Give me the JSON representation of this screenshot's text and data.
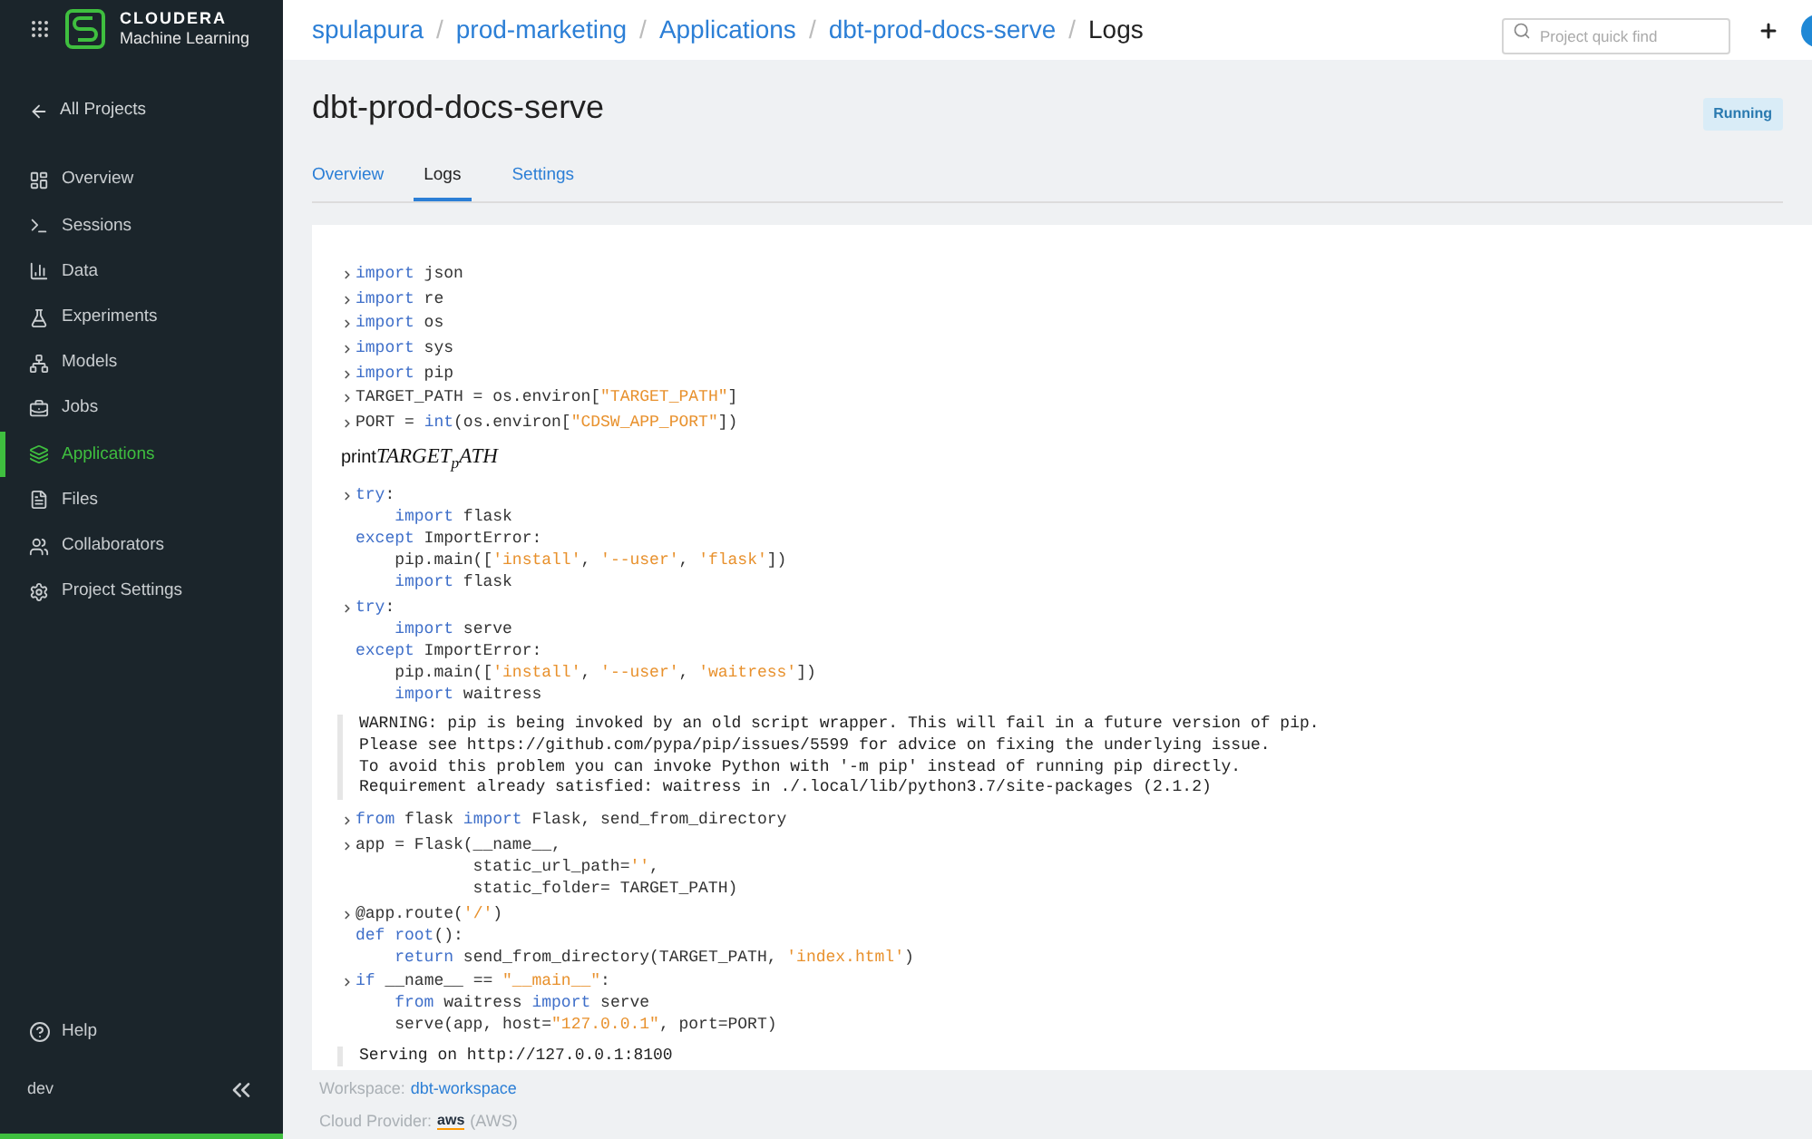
{
  "sidebar": {
    "brand": {
      "name": "CLOUDERA",
      "product": "Machine Learning"
    },
    "back_link": "All Projects",
    "items": [
      {
        "kind": "overview",
        "label": "Overview",
        "selected": false
      },
      {
        "kind": "sessions",
        "label": "Sessions",
        "selected": false
      },
      {
        "kind": "data",
        "label": "Data",
        "selected": false
      },
      {
        "kind": "experiments",
        "label": "Experiments",
        "selected": false
      },
      {
        "kind": "models",
        "label": "Models",
        "selected": false
      },
      {
        "kind": "jobs",
        "label": "Jobs",
        "selected": false
      },
      {
        "kind": "applications",
        "label": "Applications",
        "selected": true
      },
      {
        "kind": "files",
        "label": "Files",
        "selected": false
      },
      {
        "kind": "collaborators",
        "label": "Collaborators",
        "selected": false
      },
      {
        "kind": "settings",
        "label": "Project Settings",
        "selected": false
      }
    ],
    "help": "Help",
    "user": "dev"
  },
  "topbar": {
    "breadcrumb": [
      {
        "label": "spulapura",
        "link": true
      },
      {
        "label": "prod-marketing",
        "link": true
      },
      {
        "label": "Applications",
        "link": true
      },
      {
        "label": "dbt-prod-docs-serve",
        "link": true
      },
      {
        "label": "Logs",
        "link": false
      }
    ],
    "separator": "/",
    "search": {
      "placeholder": "Project quick find"
    }
  },
  "page": {
    "title": "dbt-prod-docs-serve",
    "status": "Running",
    "tabs": [
      {
        "label": "Overview",
        "selected": false
      },
      {
        "label": "Logs",
        "selected": true
      },
      {
        "label": "Settings",
        "selected": false
      }
    ]
  },
  "log": [
    {
      "kind": "code",
      "lines": [
        [
          {
            "kind": "kw",
            "text": "import"
          },
          {
            "kind": "p",
            "text": " json"
          }
        ]
      ]
    },
    {
      "kind": "code",
      "lines": [
        [
          {
            "kind": "kw",
            "text": "import"
          },
          {
            "kind": "p",
            "text": " re"
          }
        ]
      ]
    },
    {
      "kind": "code",
      "lines": [
        [
          {
            "kind": "kw",
            "text": "import"
          },
          {
            "kind": "p",
            "text": " os"
          }
        ]
      ]
    },
    {
      "kind": "code",
      "lines": [
        [
          {
            "kind": "kw",
            "text": "import"
          },
          {
            "kind": "p",
            "text": " sys"
          }
        ]
      ]
    },
    {
      "kind": "code",
      "lines": [
        [
          {
            "kind": "kw",
            "text": "import"
          },
          {
            "kind": "p",
            "text": " pip"
          }
        ]
      ]
    },
    {
      "kind": "code",
      "lines": [
        [
          {
            "kind": "p",
            "text": "TARGET_PATH = os.environ["
          },
          {
            "kind": "s",
            "text": "\"TARGET_PATH\""
          },
          {
            "kind": "p",
            "text": "]"
          }
        ]
      ]
    },
    {
      "kind": "code",
      "lines": [
        [
          {
            "kind": "p",
            "text": "PORT = "
          },
          {
            "kind": "kw",
            "text": "int"
          },
          {
            "kind": "p",
            "text": "(os.environ["
          },
          {
            "kind": "s",
            "text": "\"CDSW_APP_PORT\""
          },
          {
            "kind": "p",
            "text": "])"
          }
        ]
      ]
    },
    {
      "kind": "math",
      "prefix": "print",
      "text": "TARGET$_{p}$ATH"
    },
    {
      "kind": "code",
      "lines": [
        [
          {
            "kind": "kw",
            "text": "try"
          },
          {
            "kind": "p",
            "text": ":"
          }
        ],
        [
          {
            "kind": "kw",
            "text": "    import"
          },
          {
            "kind": "p",
            "text": " flask"
          }
        ],
        [
          {
            "kind": "kw",
            "text": "except"
          },
          {
            "kind": "p",
            "text": " ImportError:"
          }
        ],
        [
          {
            "kind": "p",
            "text": "    pip.main(["
          },
          {
            "kind": "s",
            "text": "'install'"
          },
          {
            "kind": "p",
            "text": ", "
          },
          {
            "kind": "s",
            "text": "'--user'"
          },
          {
            "kind": "p",
            "text": ", "
          },
          {
            "kind": "s",
            "text": "'flask'"
          },
          {
            "kind": "p",
            "text": "])"
          }
        ],
        [
          {
            "kind": "kw",
            "text": "    import"
          },
          {
            "kind": "p",
            "text": " flask"
          }
        ]
      ]
    },
    {
      "kind": "code",
      "lines": [
        [
          {
            "kind": "kw",
            "text": "try"
          },
          {
            "kind": "p",
            "text": ":"
          }
        ],
        [
          {
            "kind": "kw",
            "text": "    import"
          },
          {
            "kind": "p",
            "text": " serve"
          }
        ],
        [
          {
            "kind": "kw",
            "text": "except"
          },
          {
            "kind": "p",
            "text": " ImportError:"
          }
        ],
        [
          {
            "kind": "p",
            "text": "    pip.main(["
          },
          {
            "kind": "s",
            "text": "'install'"
          },
          {
            "kind": "p",
            "text": ", "
          },
          {
            "kind": "s",
            "text": "'--user'"
          },
          {
            "kind": "p",
            "text": ", "
          },
          {
            "kind": "s",
            "text": "'waitress'"
          },
          {
            "kind": "p",
            "text": "])"
          }
        ],
        [
          {
            "kind": "kw",
            "text": "    import"
          },
          {
            "kind": "p",
            "text": " waitress"
          }
        ]
      ]
    },
    {
      "kind": "output",
      "lines": [
        "WARNING: pip is being invoked by an old script wrapper. This will fail in a future version of pip.",
        "Please see https://github.com/pypa/pip/issues/5599 for advice on fixing the underlying issue.",
        "To avoid this problem you can invoke Python with '-m pip' instead of running pip directly.",
        "Requirement already satisfied: waitress in ./.local/lib/python3.7/site-packages (2.1.2)"
      ]
    },
    {
      "kind": "code",
      "lines": [
        [
          {
            "kind": "kw",
            "text": "from"
          },
          {
            "kind": "p",
            "text": " flask "
          },
          {
            "kind": "kw",
            "text": "import"
          },
          {
            "kind": "p",
            "text": " Flask, send_from_directory"
          }
        ]
      ]
    },
    {
      "kind": "code",
      "lines": [
        [
          {
            "kind": "p",
            "text": "app = Flask(__name__,"
          }
        ],
        [
          {
            "kind": "p",
            "text": "            static_url_path="
          },
          {
            "kind": "s",
            "text": "''"
          },
          {
            "kind": "p",
            "text": ","
          }
        ],
        [
          {
            "kind": "p",
            "text": "            static_folder= TARGET_PATH)"
          }
        ]
      ]
    },
    {
      "kind": "code",
      "lines": [
        [
          {
            "kind": "p",
            "text": "@app.route("
          },
          {
            "kind": "s",
            "text": "'/'"
          },
          {
            "kind": "p",
            "text": ")"
          }
        ],
        [
          {
            "kind": "kw",
            "text": "def root"
          },
          {
            "kind": "p",
            "text": "():"
          }
        ],
        [
          {
            "kind": "kw",
            "text": "    return"
          },
          {
            "kind": "p",
            "text": " send_from_directory(TARGET_PATH, "
          },
          {
            "kind": "s",
            "text": "'index.html'"
          },
          {
            "kind": "p",
            "text": ")"
          }
        ]
      ]
    },
    {
      "kind": "code",
      "lines": [
        [
          {
            "kind": "kw",
            "text": "if"
          },
          {
            "kind": "p",
            "text": " __name__ == "
          },
          {
            "kind": "s",
            "text": "\"__main__\""
          },
          {
            "kind": "p",
            "text": ":"
          }
        ],
        [
          {
            "kind": "kw",
            "text": "    from"
          },
          {
            "kind": "p",
            "text": " waitress "
          },
          {
            "kind": "kw",
            "text": "import"
          },
          {
            "kind": "p",
            "text": " serve"
          }
        ],
        [
          {
            "kind": "p",
            "text": "    serve(app, host="
          },
          {
            "kind": "s",
            "text": "\"127.0.0.1\""
          },
          {
            "kind": "p",
            "text": ", port=PORT)"
          }
        ]
      ]
    },
    {
      "kind": "output",
      "lines": [
        "Serving on http://127.0.0.1:8100"
      ]
    }
  ],
  "footer": {
    "workspace": {
      "label": "Workspace:",
      "value": "dbt-workspace"
    },
    "cloud_provider": {
      "label": "Cloud Provider:",
      "logo": "aws",
      "value": "(AWS)"
    }
  }
}
